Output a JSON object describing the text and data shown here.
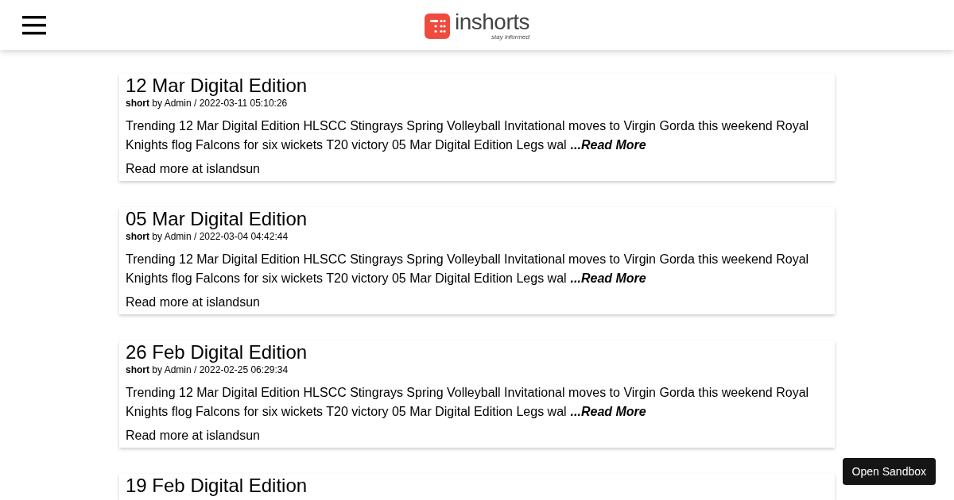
{
  "header": {
    "logo": {
      "name": "inshorts",
      "tagline": "stay informed"
    }
  },
  "cards": [
    {
      "title": "12 Mar Digital Edition",
      "meta": "**short** by Admin / 2022-03-11 05:10:26",
      "summary": "Trending 12 Mar Digital Edition HLSCC Stingrays Spring Volleyball Invitational moves to Virgin Gorda this weekend Royal Knights flog Falcons for six wickets T20 victory 05 Mar Digital Edition Legs wal",
      "read_more": "...Read More",
      "source": "Read more at islandsun"
    },
    {
      "title": "05 Mar Digital Edition",
      "meta": "**short** by Admin / 2022-03-04 04:42:44",
      "summary": "Trending 12 Mar Digital Edition HLSCC Stingrays Spring Volleyball Invitational moves to Virgin Gorda this weekend Royal Knights flog Falcons for six wickets T20 victory 05 Mar Digital Edition Legs wal",
      "read_more": "...Read More",
      "source": "Read more at islandsun"
    },
    {
      "title": "26 Feb Digital Edition",
      "meta": "**short** by Admin / 2022-02-25 06:29:34",
      "summary": "Trending 12 Mar Digital Edition HLSCC Stingrays Spring Volleyball Invitational moves to Virgin Gorda this weekend Royal Knights flog Falcons for six wickets T20 victory 05 Mar Digital Edition Legs wal",
      "read_more": "...Read More",
      "source": "Read more at islandsun"
    },
    {
      "title": "19 Feb Digital Edition"
    }
  ],
  "sandbox_button": "Open Sandbox"
}
